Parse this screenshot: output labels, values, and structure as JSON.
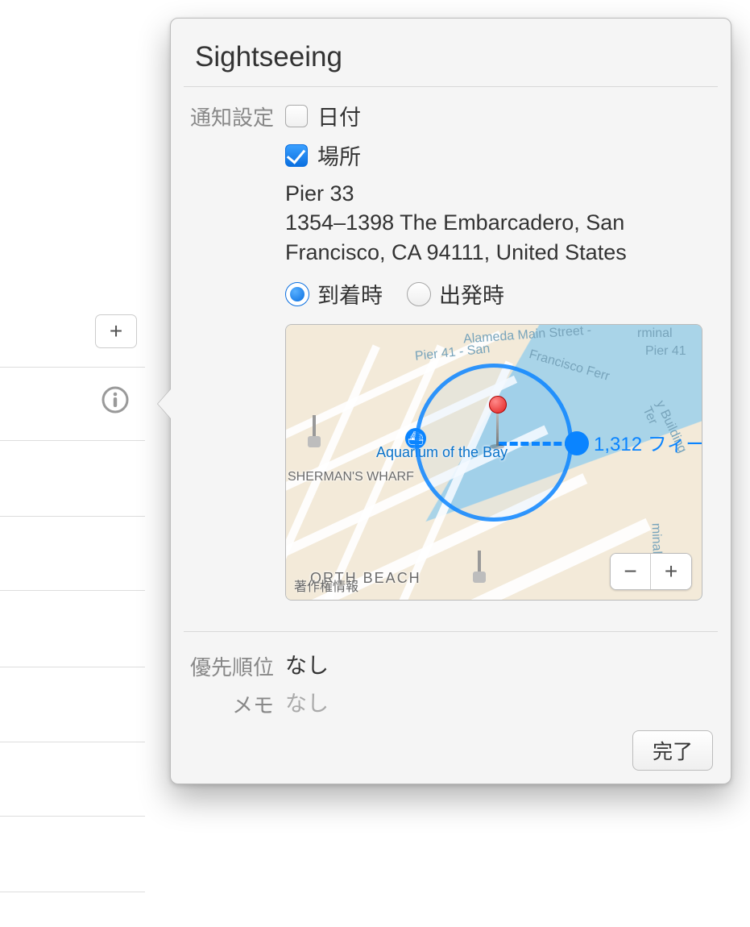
{
  "left": {
    "add_label": "+"
  },
  "popover": {
    "title": "Sightseeing",
    "notify_label": "通知設定",
    "date_label": "日付",
    "date_checked": false,
    "location_label": "場所",
    "location_checked": true,
    "address_line1": "Pier 33",
    "address_line2": "1354–1398 The Embarcadero, San Francisco, CA  94111, United States",
    "radio_arrive": "到着時",
    "radio_leave": "出発時",
    "radio_selected": "arrive",
    "priority_label": "優先順位",
    "priority_value": "なし",
    "note_label": "メモ",
    "note_placeholder": "なし",
    "done_label": "完了"
  },
  "map": {
    "poi_aquarium": "Aquarium of the Bay",
    "poi_wharf": "SHERMAN'S WHARF",
    "poi_northbeach": "ORTH BEACH",
    "arc_pier41": "Pier 41 - San",
    "arc_alameda": "Alameda Main Street -",
    "arc_terminal": "rminal",
    "arc_pier41b": "Pier 41",
    "arc_ferry1": "Francisco Ferr",
    "arc_ferry2": "y Building Ter",
    "arc_ferry3": "minal",
    "distance": "1,312 フィー",
    "copyright": "著作権情報",
    "zoom_out": "−",
    "zoom_in": "+"
  }
}
